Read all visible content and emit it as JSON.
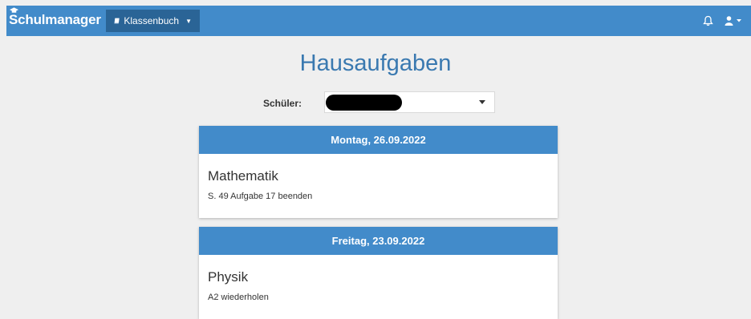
{
  "navbar": {
    "brand": "Schulmanager",
    "classbook_label": "Klassenbuch",
    "icons": [
      "graduation-cap-icon",
      "book-icon",
      "caret-down-icon",
      "bell-icon",
      "user-icon"
    ]
  },
  "page": {
    "title": "Hausaufgaben",
    "student_label": "Schüler:",
    "student_value_redacted": true
  },
  "homework": [
    {
      "date": "Montag, 26.09.2022",
      "subject": "Mathematik",
      "task": "S. 49 Aufgabe 17 beenden"
    },
    {
      "date": "Freitag, 23.09.2022",
      "subject": "Physik",
      "task": "A2 wiederholen"
    }
  ],
  "colors": {
    "navbar": "#428bca",
    "button": "#2a6496",
    "title": "#3a79b0",
    "background": "#efefef"
  }
}
